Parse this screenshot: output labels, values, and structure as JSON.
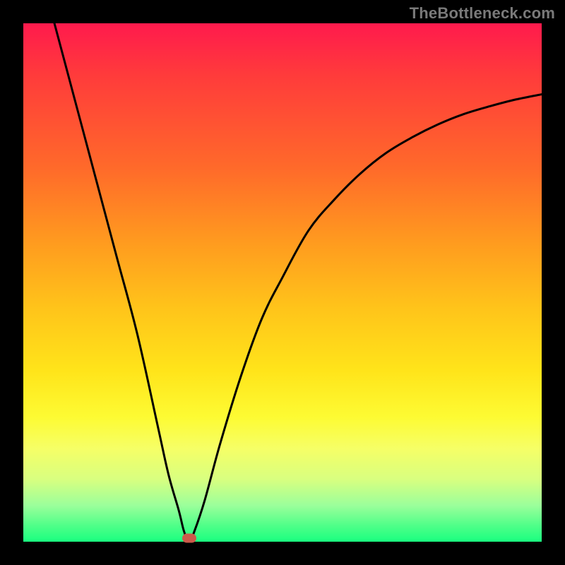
{
  "watermark": "TheBottleneck.com",
  "chart_data": {
    "type": "line",
    "title": "",
    "xlabel": "",
    "ylabel": "",
    "xlim": [
      0,
      100
    ],
    "ylim": [
      0,
      100
    ],
    "grid": false,
    "series": [
      {
        "name": "curve",
        "x": [
          6,
          10,
          14,
          18,
          22,
          26,
          28,
          30,
          31,
          32,
          33,
          35,
          38,
          42,
          46,
          50,
          55,
          60,
          65,
          70,
          75,
          80,
          85,
          90,
          95,
          100
        ],
        "values": [
          100,
          85,
          70,
          55,
          40,
          22,
          13,
          6,
          2,
          0,
          2,
          8,
          19,
          32,
          43,
          51,
          60,
          66,
          71,
          75,
          78,
          80.5,
          82.5,
          84,
          85.3,
          86.3
        ]
      }
    ],
    "annotations": [
      {
        "name": "min-marker",
        "x": 32,
        "y": 0.7
      }
    ],
    "background_gradient": {
      "top": "#ff1a4d",
      "bottom": "#1aff80"
    }
  }
}
